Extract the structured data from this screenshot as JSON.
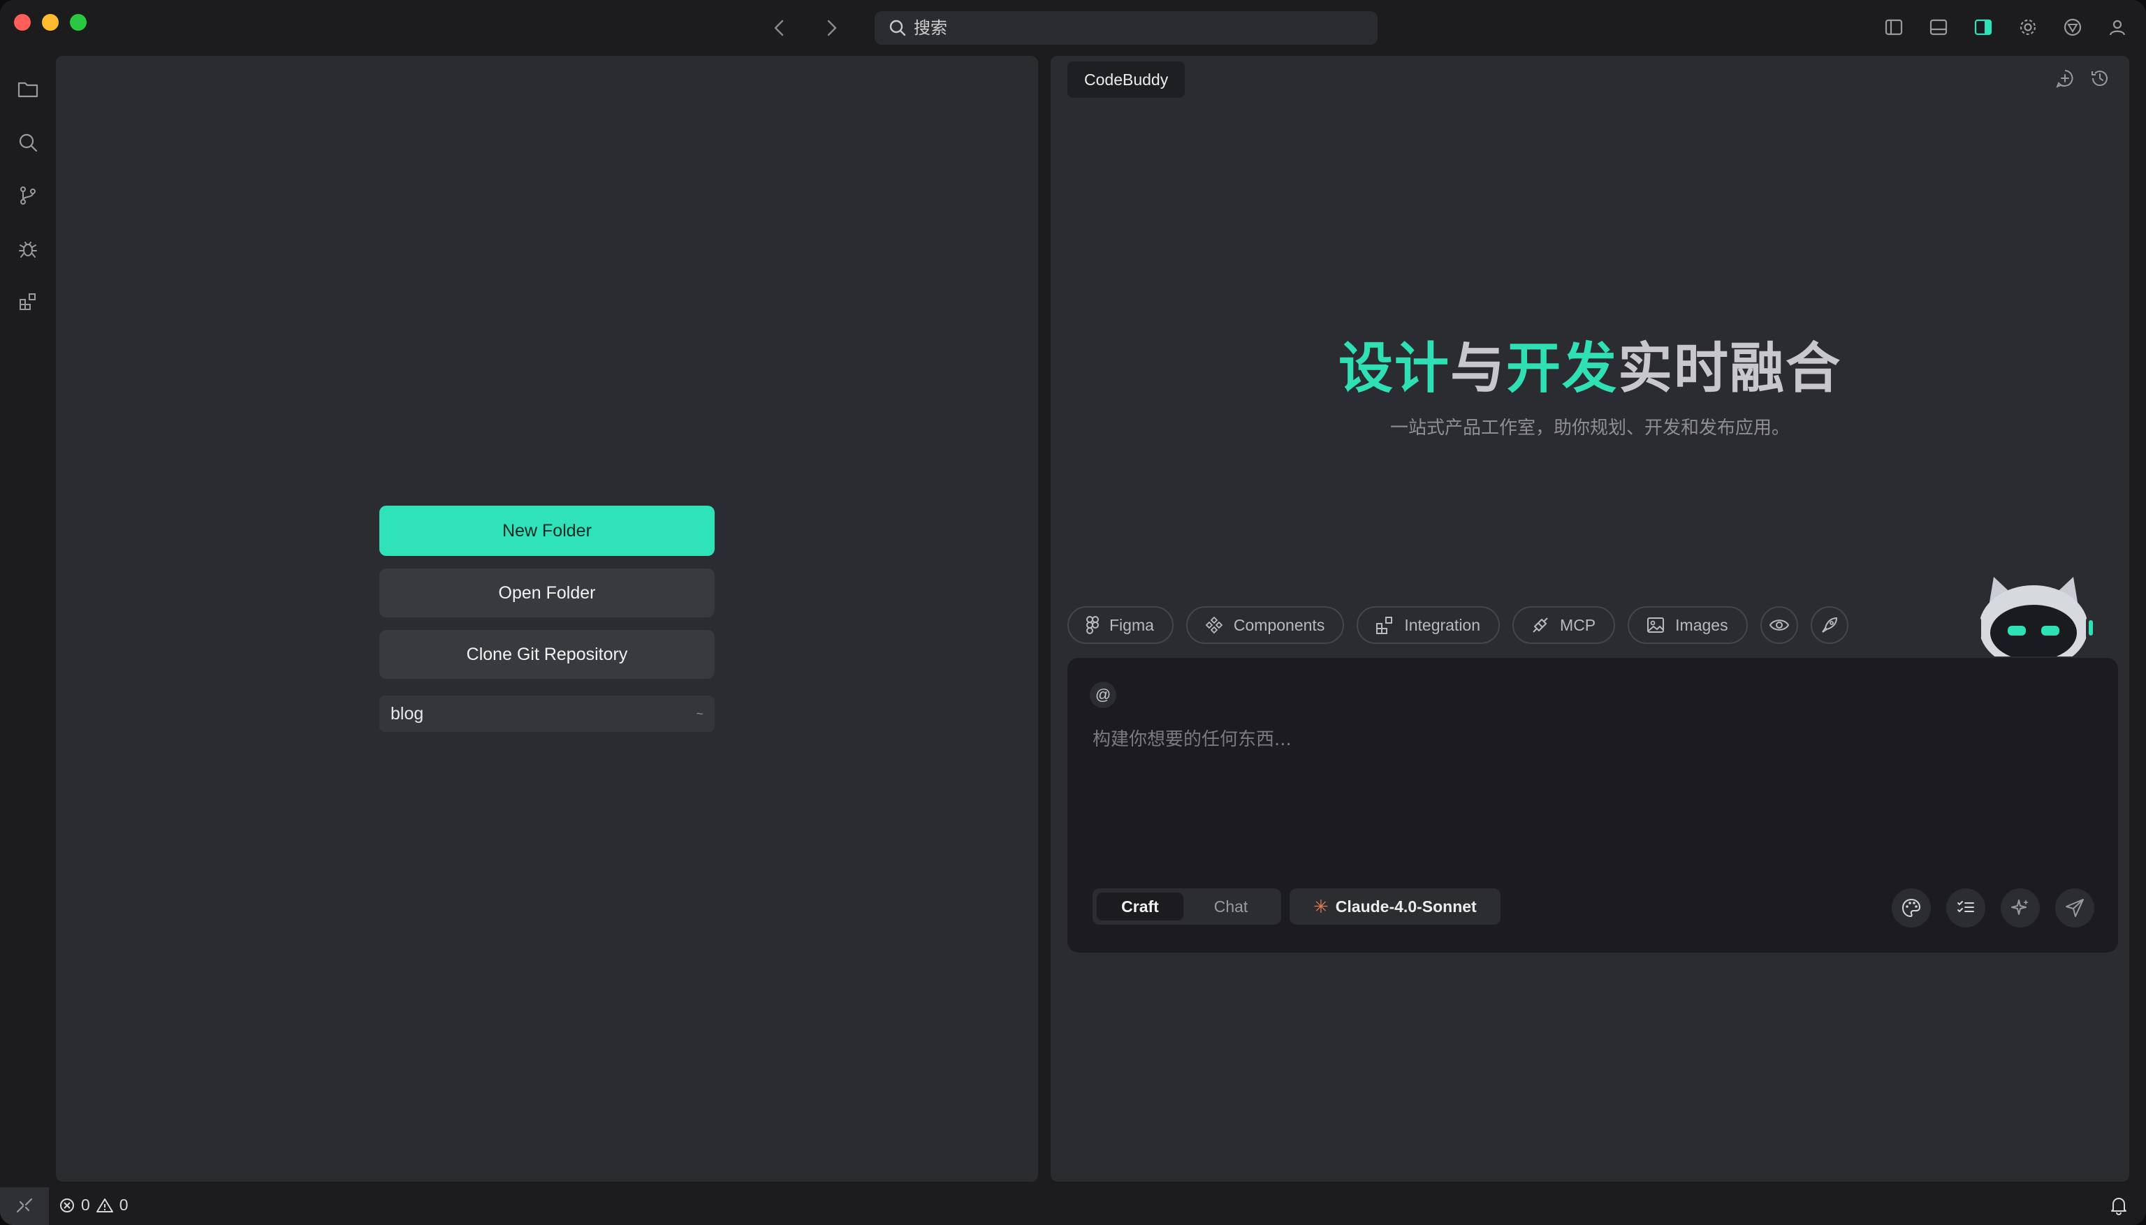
{
  "titlebar": {
    "search_placeholder": "搜索",
    "icons": [
      "sidebar-left-icon",
      "panel-bottom-icon",
      "sidebar-right-icon",
      "gear-icon",
      "shield-icon",
      "account-icon"
    ]
  },
  "activitybar": {
    "items": [
      "explorer-icon",
      "search-icon",
      "source-control-icon",
      "debug-icon",
      "extensions-icon"
    ]
  },
  "welcome": {
    "new_folder": "New Folder",
    "open_folder": "Open Folder",
    "clone_repo": "Clone Git Repository",
    "recent": {
      "name": "blog",
      "path": "~"
    }
  },
  "assistant": {
    "tab_label": "CodeBuddy",
    "hero": {
      "part1": "设计",
      "part2": "与",
      "part3": "开发",
      "part4": "实时融合"
    },
    "subtitle": "一站式产品工作室，助你规划、开发和发布应用。",
    "chips": [
      "Figma",
      "Components",
      "Integration",
      "MCP",
      "Images"
    ],
    "composer": {
      "at_symbol": "@",
      "placeholder": "构建你想要的任何东西..."
    },
    "modes": {
      "craft": "Craft",
      "chat": "Chat",
      "active": "Craft"
    },
    "model": "Claude-4.0-Sonnet"
  },
  "statusbar": {
    "errors": "0",
    "warnings": "0"
  },
  "colors": {
    "accent": "#30e2b9",
    "panel": "#2b2c30",
    "window": "#1c1c1f"
  }
}
